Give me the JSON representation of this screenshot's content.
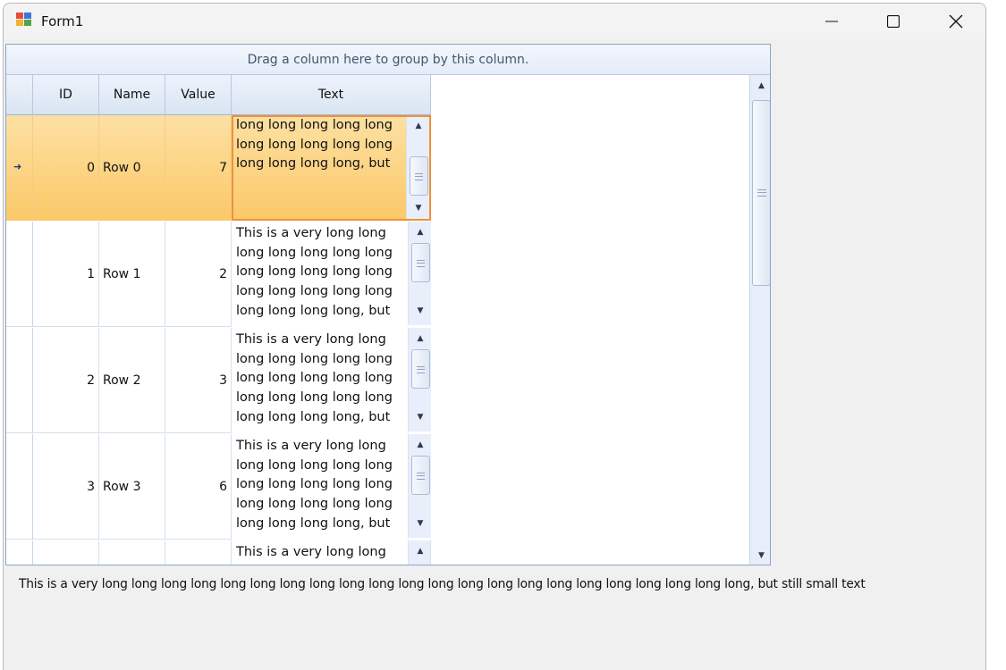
{
  "window": {
    "title": "Form1",
    "icon": "winforms-app-icon",
    "controls": {
      "minimize": "minimize-icon",
      "maximize": "maximize-icon",
      "close": "close-icon"
    }
  },
  "grid": {
    "group_panel_text": "Drag a column here to group by this column.",
    "columns": [
      "ID",
      "Name",
      "Value",
      "Text"
    ],
    "rows": [
      {
        "id": "0",
        "name": "Row 0",
        "value": "7",
        "text": "long long long long long\nlong long long long long\nlong long long long, but",
        "selected": true
      },
      {
        "id": "1",
        "name": "Row 1",
        "value": "2",
        "text": "This is a very long long\nlong long long long long\nlong long long long long\nlong long long long long\nlong long long long, but",
        "selected": false
      },
      {
        "id": "2",
        "name": "Row 2",
        "value": "3",
        "text": "This is a very long long\nlong long long long long\nlong long long long long\nlong long long long long\nlong long long long, but",
        "selected": false
      },
      {
        "id": "3",
        "name": "Row 3",
        "value": "6",
        "text": "This is a very long long\nlong long long long long\nlong long long long long\nlong long long long long\nlong long long long, but",
        "selected": false
      },
      {
        "id": "",
        "name": "",
        "value": "",
        "text": "This is a very long long",
        "selected": false
      }
    ],
    "focused_row_indicator": "row-pointer-icon",
    "colors": {
      "selected_row": "#fbc968",
      "focused_cell_border": "#f0913a",
      "header": "#d9e4f3",
      "grid_lines": "#d4e0ef"
    }
  },
  "label": {
    "text": "This is a very long long long long long long long long long long long long long long long long long long long long long long, but still small text"
  }
}
